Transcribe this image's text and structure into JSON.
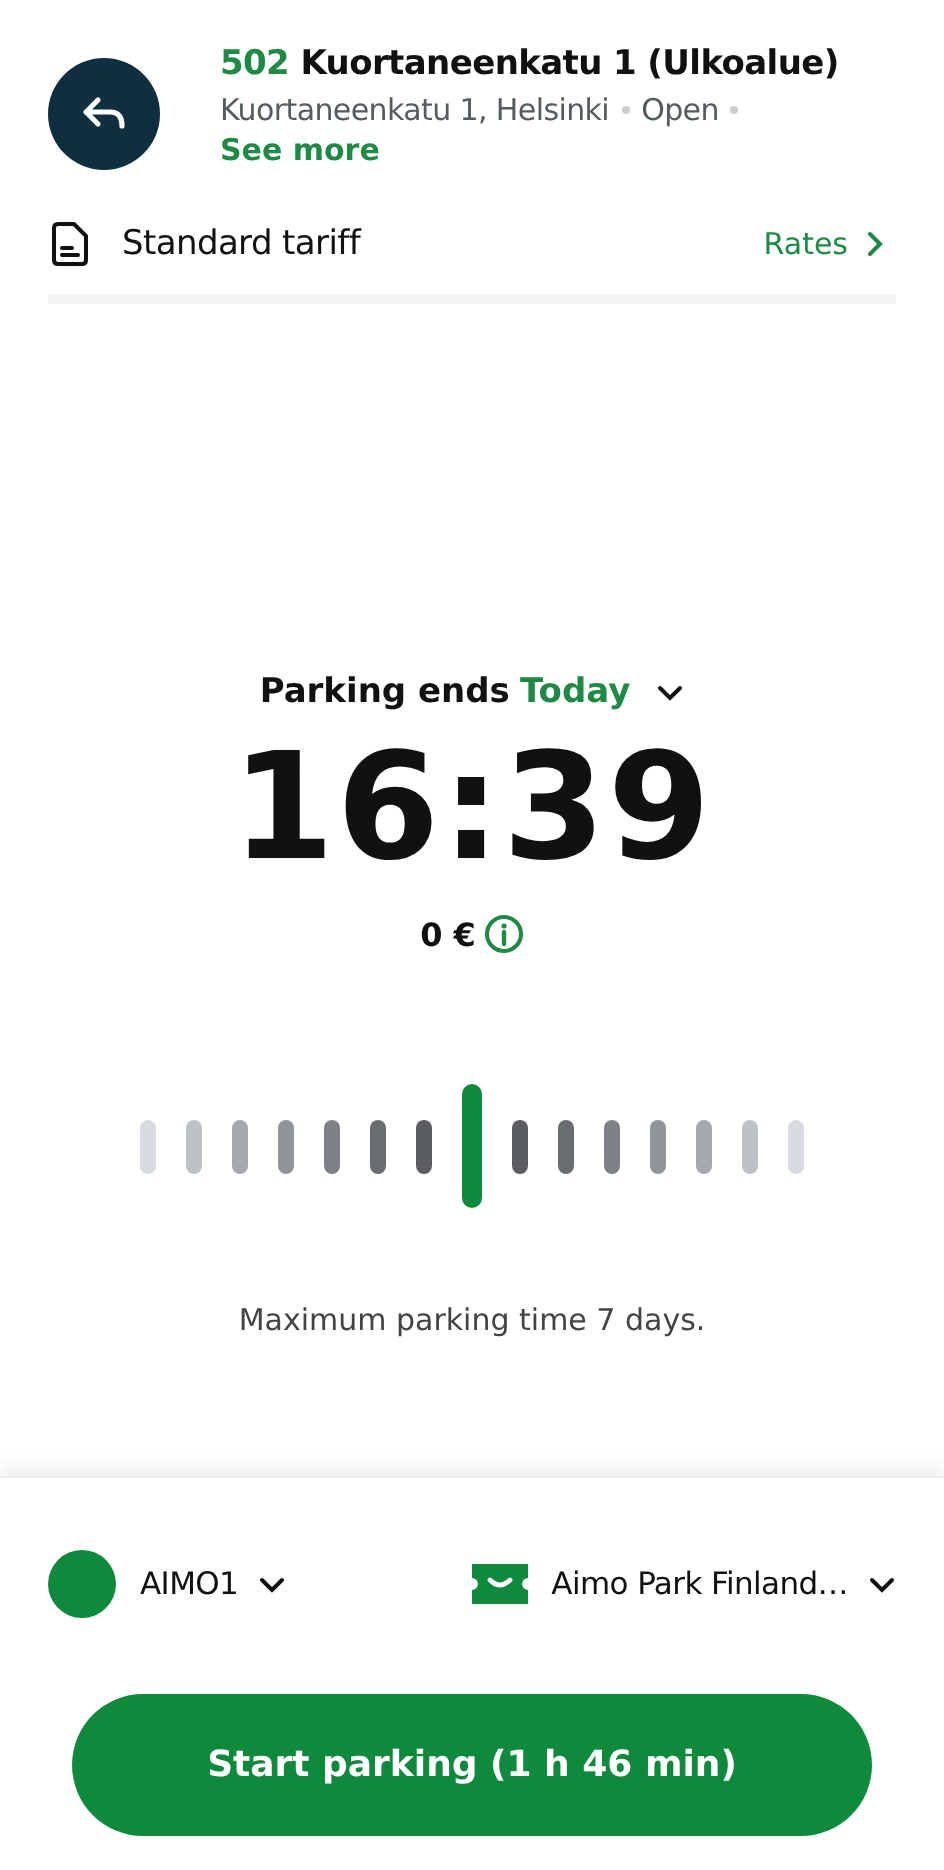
{
  "location": {
    "code": "502",
    "name": "Kuortaneenkatu 1 (Ulkoalue)",
    "address": "Kuortaneenkatu 1, Helsinki",
    "status": "Open",
    "see_more": "See more"
  },
  "tariff": {
    "label": "Standard tariff",
    "link": "Rates"
  },
  "parking": {
    "label": "Parking ends",
    "day": "Today",
    "time": "16:39",
    "price": "0 €",
    "max_note": "Maximum parking time 7 days."
  },
  "vehicle": {
    "plate": "AIMO1"
  },
  "payment": {
    "label": "Aimo Park Finland…"
  },
  "start_button": "Start parking (1 h 46 min)"
}
